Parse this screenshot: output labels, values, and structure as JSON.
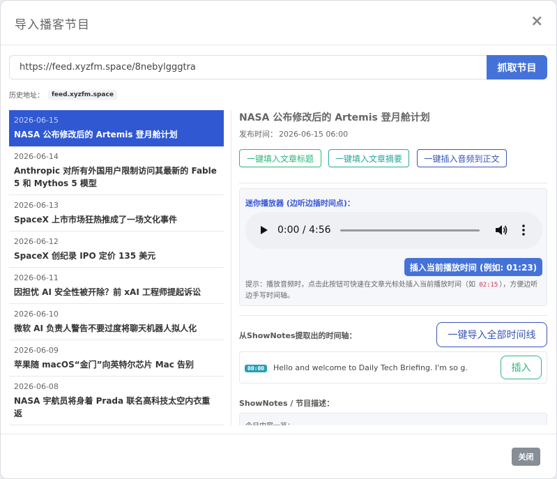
{
  "modal": {
    "title": "导入播客节目",
    "close_symbol": "×"
  },
  "feed": {
    "url_value": "https://feed.xyzfm.space/8nebylgggtra",
    "fetch_label": "抓取节目"
  },
  "history": {
    "label": "历史地址：",
    "items": [
      "feed.xyzfm.space"
    ]
  },
  "episodes": [
    {
      "date": "2026-06-15",
      "title": "NASA 公布修改后的 Artemis 登月舱计划",
      "active": true
    },
    {
      "date": "2026-06-14",
      "title": "Anthropic 对所有外国用户限制访问其最新的 Fable 5 和 Mythos 5 模型"
    },
    {
      "date": "2026-06-13",
      "title": "SpaceX 上市市场狂热推成了一场文化事件"
    },
    {
      "date": "2026-06-12",
      "title": "SpaceX 创纪录 IPO 定价 135 美元"
    },
    {
      "date": "2026-06-11",
      "title": "因担忧 AI 安全性被开除？前 xAI 工程师提起诉讼"
    },
    {
      "date": "2026-06-10",
      "title": "微软 AI 负责人警告不要过度将聊天机器人拟人化"
    },
    {
      "date": "2026-06-09",
      "title": "苹果随 macOS“金门”向英特尔芯片 Mac 告别"
    },
    {
      "date": "2026-06-08",
      "title": "NASA 宇航员将身着 Prada 联名高科技太空内衣重返"
    }
  ],
  "detail": {
    "title": "NASA 公布修改后的 Artemis 登月舱计划",
    "published_label": "发布时间：",
    "published_value": "2026-06-15 06:00",
    "fill_title_label": "一键填入文章标题",
    "fill_summary_label": "一键填入文章摘要",
    "insert_audio_label": "一键插入音频到正文"
  },
  "player": {
    "label": "迷你播放器 (边听边插时间点)：",
    "current_time": "0:00",
    "separator": " / ",
    "duration": "4:56",
    "progress": 0,
    "insert_time_label": "插入当前播放时间 (例如: 01:23)",
    "hint_before": "提示：播放音频时，点击此按钮可快速在文章光标处插入当前播放时间（如 ",
    "hint_code": "02:15",
    "hint_after": "），方便边听边手写时间轴。"
  },
  "timeline": {
    "label": "从ShowNotes提取出的时间轴：",
    "import_all_label": "一键导入全部时间线",
    "items": [
      {
        "time": "00:00",
        "text": "Hello and welcome to Daily Tech Briefing. I'm so g...",
        "insert_label": "插入"
      }
    ]
  },
  "shownotes": {
    "label": "ShowNotes / 节目描述：",
    "text": "今日内容一览："
  },
  "footer": {
    "close_label": "关闭"
  }
}
